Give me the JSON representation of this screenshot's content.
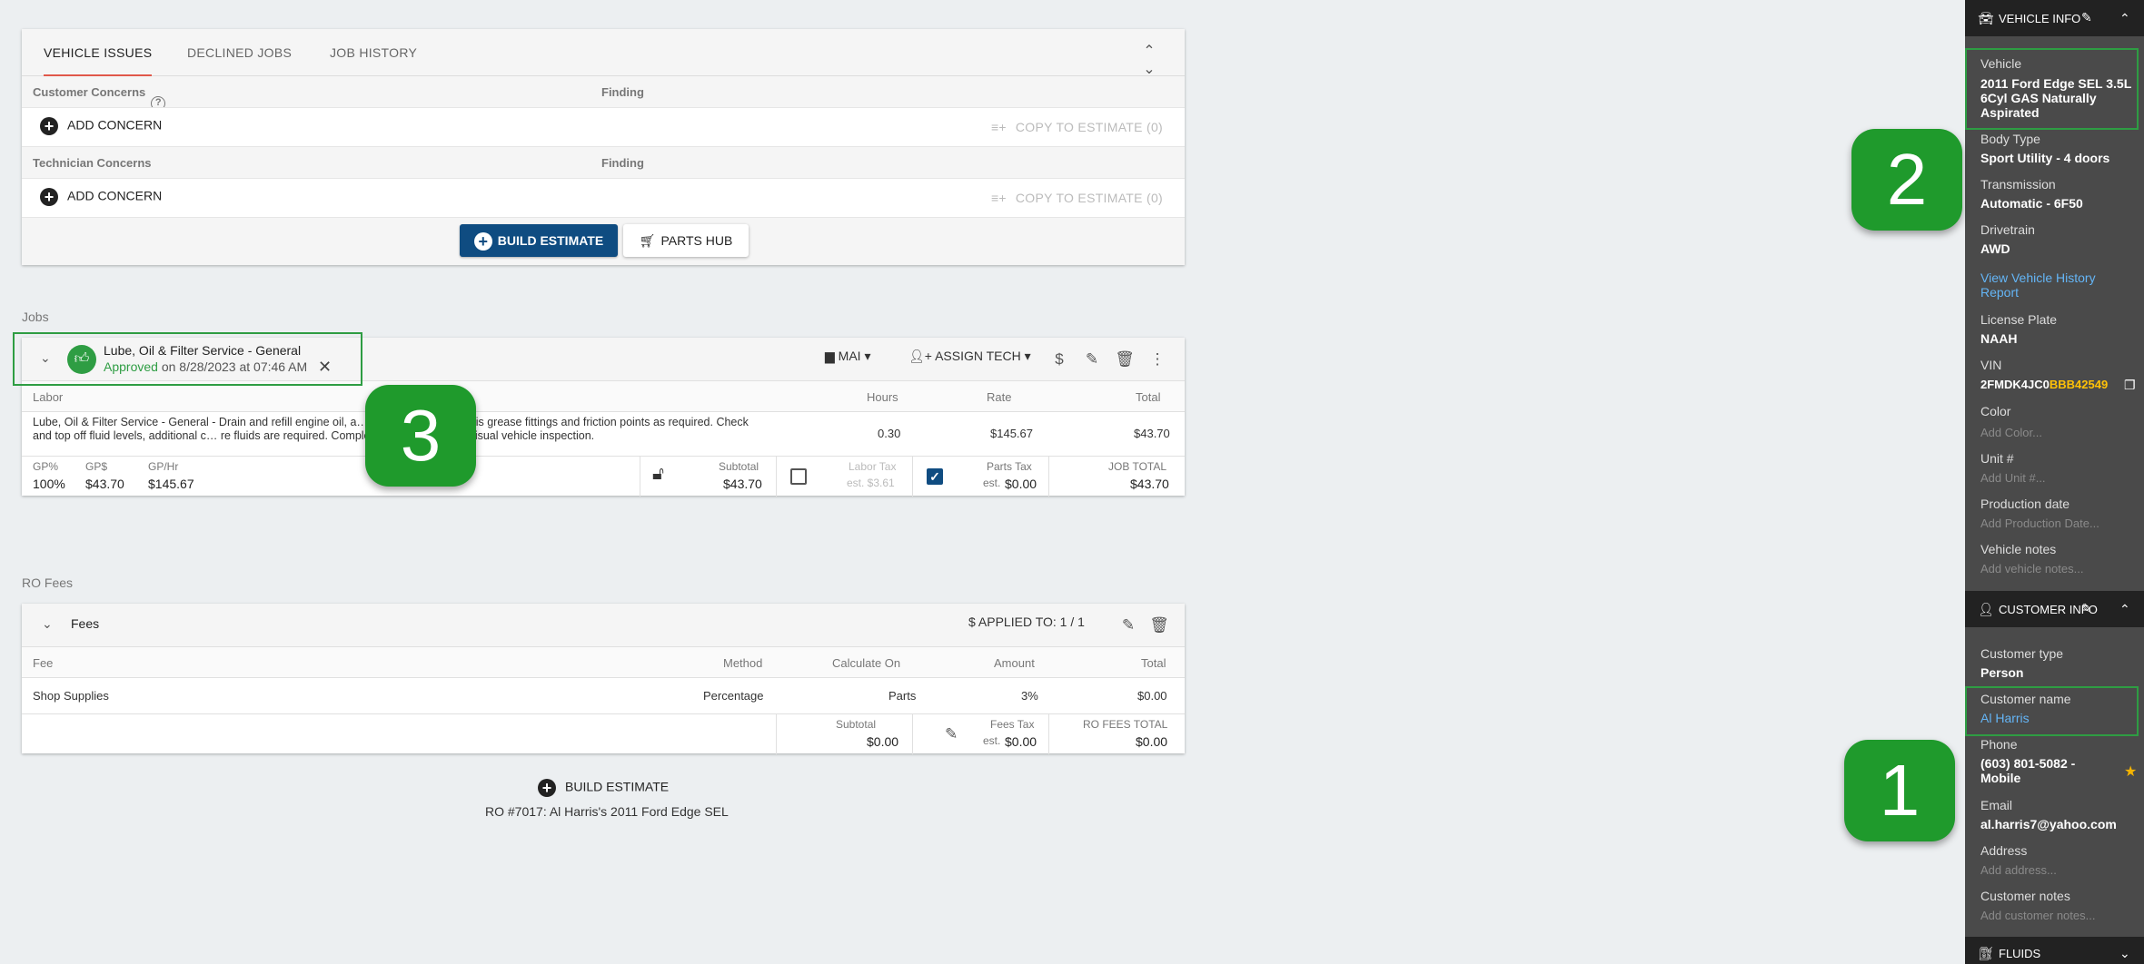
{
  "issues": {
    "tabs": [
      "VEHICLE ISSUES",
      "DECLINED JOBS",
      "JOB HISTORY"
    ],
    "customer_concerns_label": "Customer Concerns",
    "technician_concerns_label": "Technician Concerns",
    "finding_label": "Finding",
    "add_concern_label": "ADD CONCERN",
    "copy_to_estimate_label": "COPY TO ESTIMATE (0)",
    "build_estimate_label": "BUILD ESTIMATE",
    "parts_hub_label": "PARTS HUB"
  },
  "jobs": {
    "section_label": "Jobs",
    "job_title": "Lube, Oil & Filter Service - General",
    "status": "Approved",
    "status_suffix": "on 8/28/2023 at 07:46 AM",
    "category": "MAI",
    "assign_tech_label": "ASSIGN TECH",
    "columns": {
      "labor": "Labor",
      "hours": "Hours",
      "rate": "Rate",
      "total": "Total"
    },
    "labor_description": "Lube, Oil & Filter Service - General -  Drain and refill engine oil, a… r and lubricate chassis grease fittings and friction points as required.  Check and top off fluid levels, additional c… re fluids are required.  Complete a complimentary visual vehicle inspection.",
    "hours": "0.30",
    "rate": "$145.67",
    "total": "$43.70",
    "footer": {
      "gp_pct_label": "GP%",
      "gp_pct": "100%",
      "gp_dollar_label": "GP$",
      "gp_dollar": "$43.70",
      "gp_hr_label": "GP/Hr",
      "gp_hr": "$145.67",
      "subtotal_label": "Subtotal",
      "subtotal": "$43.70",
      "labor_tax_label": "Labor Tax",
      "labor_tax": "est. $3.61",
      "parts_tax_label": "Parts Tax",
      "parts_tax_est": "est.",
      "parts_tax": "$0.00",
      "job_total_label": "JOB TOTAL",
      "job_total": "$43.70"
    }
  },
  "fees": {
    "section_label": "RO Fees",
    "title": "Fees",
    "applied_to": "APPLIED TO: 1 / 1",
    "columns": {
      "fee": "Fee",
      "method": "Method",
      "calculate_on": "Calculate On",
      "amount": "Amount",
      "total": "Total"
    },
    "row": {
      "fee": "Shop Supplies",
      "method": "Percentage",
      "calculate_on": "Parts",
      "amount": "3%",
      "total": "$0.00"
    },
    "footer": {
      "subtotal_label": "Subtotal",
      "subtotal": "$0.00",
      "fees_tax_label": "Fees Tax",
      "fees_tax_est": "est.",
      "fees_tax": "$0.00",
      "ro_fees_total_label": "RO FEES TOTAL",
      "ro_fees_total": "$0.00"
    }
  },
  "bottom": {
    "build_estimate_label": "BUILD ESTIMATE",
    "ro_caption": "RO #7017: Al Harris's 2011 Ford Edge SEL"
  },
  "sidebar": {
    "vehicle_info_title": "VEHICLE INFO",
    "vehicle_label": "Vehicle",
    "vehicle_value": "2011 Ford Edge SEL 3.5L 6Cyl GAS Naturally Aspirated",
    "body_type_label": "Body Type",
    "body_type_value": "Sport Utility - 4 doors",
    "transmission_label": "Transmission",
    "transmission_value": "Automatic - 6F50",
    "drivetrain_label": "Drivetrain",
    "drivetrain_value": "AWD",
    "history_link": "View Vehicle History Report",
    "license_label": "License Plate",
    "license_value": "NAAH",
    "vin_label": "VIN",
    "vin_prefix": "2FMDK4JC0",
    "vin_highlight": "BBB42549",
    "color_label": "Color",
    "color_placeholder": "Add Color...",
    "unit_label": "Unit #",
    "unit_placeholder": "Add Unit #...",
    "production_label": "Production date",
    "production_placeholder": "Add Production Date...",
    "vehicle_notes_label": "Vehicle notes",
    "vehicle_notes_placeholder": "Add vehicle notes...",
    "customer_info_title": "CUSTOMER INFO",
    "customer_type_label": "Customer type",
    "customer_type_value": "Person",
    "customer_name_label": "Customer name",
    "customer_name_value": "Al Harris",
    "phone_label": "Phone",
    "phone_value": "(603) 801-5082 - Mobile",
    "email_label": "Email",
    "email_value": "al.harris7@yahoo.com",
    "address_label": "Address",
    "address_placeholder": "Add address...",
    "customer_notes_label": "Customer notes",
    "customer_notes_placeholder": "Add customer notes...",
    "fluids_title": "FLUIDS"
  },
  "callouts": [
    "1",
    "2",
    "3"
  ],
  "colors": {
    "primary": "#0f4c81",
    "approved": "#2e9d43",
    "callout": "#1f9a2c",
    "vin_highlight": "#ffc107",
    "link": "#64b5f6",
    "tab_underline": "#e0584a"
  }
}
